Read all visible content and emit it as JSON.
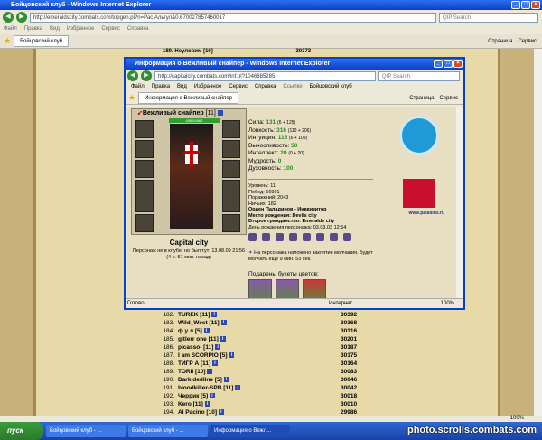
{
  "main_window": {
    "title": "Бойцовский клуб - Windows Internet Explorer",
    "url": "http://emeraldscity.combats.com/topgen.pl?n=Рас Альгул&0.670027857460017",
    "search_placeholder": "QIP Search",
    "menu": [
      "Файл",
      "Правка",
      "Вид",
      "Избранное",
      "Сервис",
      "Справка"
    ],
    "tab": "Бойцовский клуб",
    "toolbar_right": [
      "Страница",
      "Сервис"
    ],
    "status_zoom": "100%"
  },
  "top_row": {
    "num": "180",
    "nick": "Неуловим [10]",
    "score": "30373"
  },
  "rows": [
    {
      "num": "182.",
      "nick": "TUREK [11]",
      "score": "30392"
    },
    {
      "num": "183.",
      "nick": "Wild_West [11]",
      "score": "30368"
    },
    {
      "num": "184.",
      "nick": "ф у л [5]",
      "score": "30316"
    },
    {
      "num": "185.",
      "nick": "gitlerr one [11]",
      "score": "30201"
    },
    {
      "num": "186.",
      "nick": "picasso- [11]",
      "score": "30187"
    },
    {
      "num": "187.",
      "nick": "I am SCORPIO [5]",
      "score": "30175"
    },
    {
      "num": "188.",
      "nick": "ТИГР А [11]",
      "score": "30164"
    },
    {
      "num": "189.",
      "nick": "TORII [10]",
      "score": "30083"
    },
    {
      "num": "190.",
      "nick": "Dark dedline [5]",
      "score": "30046"
    },
    {
      "num": "191.",
      "nick": "bloodkiller-SPB [11]",
      "score": "30042"
    },
    {
      "num": "192.",
      "nick": "Черрик [5]",
      "score": "30018"
    },
    {
      "num": "193.",
      "nick": "Kero [11]",
      "score": "30010"
    },
    {
      "num": "194.",
      "nick": "Al Pacino [10]",
      "score": "29986"
    }
  ],
  "popup": {
    "title": "Информация о Вежливый снайпер - Windows Internet Explorer",
    "url": "http://capitalcity.combats.com/inf.pl?1046685285",
    "search_placeholder": "QIP Search",
    "menu": [
      "Файл",
      "Правка",
      "Вид",
      "Избранное",
      "Сервис",
      "Справка"
    ],
    "menu_extra": "Ссылки",
    "menu_tab": "Бойцовский клуб",
    "tab": "Информация о Вежливый снайпер",
    "toolbar_right": [
      "Страница",
      "Сервис"
    ],
    "status": "Готово",
    "status_zone": "Интернет",
    "zoom": "100%"
  },
  "character": {
    "name": "Вежливый снайпер",
    "level": "[11]",
    "hp": "4562/4562",
    "city": "Capital city",
    "note": "Персонаж не в клубе, но был тут: 13.08.09 21:56 (4 ч. 51 мин. назад)"
  },
  "stats": [
    {
      "label": "Сила:",
      "value": "131",
      "extra": "(6 + 125)"
    },
    {
      "label": "Ловкость:",
      "value": "316",
      "extra": "(110 + 206)"
    },
    {
      "label": "Интуиция:",
      "value": "115",
      "extra": "(6 + 109)"
    },
    {
      "label": "Выносливость:",
      "value": "50",
      "extra": ""
    },
    {
      "label": "Интеллект:",
      "value": "20",
      "extra": "(0 + 20)"
    },
    {
      "label": "Мудрость:",
      "value": "0",
      "extra": ""
    },
    {
      "label": "Духовность:",
      "value": "100",
      "extra": ""
    }
  ],
  "info": [
    "Уровень: 11",
    "Побед: 66991",
    "Поражений: 2043",
    "Ничьих: 182",
    "Орден Паладинов - Инквизитор",
    "Место рождения: Devils city",
    "Второе гражданство: Emeralds city",
    "День рождения персонажа: 03.03.03 12:54"
  ],
  "curse": "На персонажа наложено заклятие молчания. Будет молчать еще 9 мин. 53 сек.",
  "bouquet_title": "Подарены букеты цветов:",
  "logo_url": "www.paladins.ru",
  "taskbar": {
    "start": "пуск",
    "buttons": [
      "Бойцовский клуб - ...",
      "Бойцовский клуб - ...",
      "Информация о Вежл..."
    ],
    "watermark": "photo.scrolls.combats.com"
  }
}
